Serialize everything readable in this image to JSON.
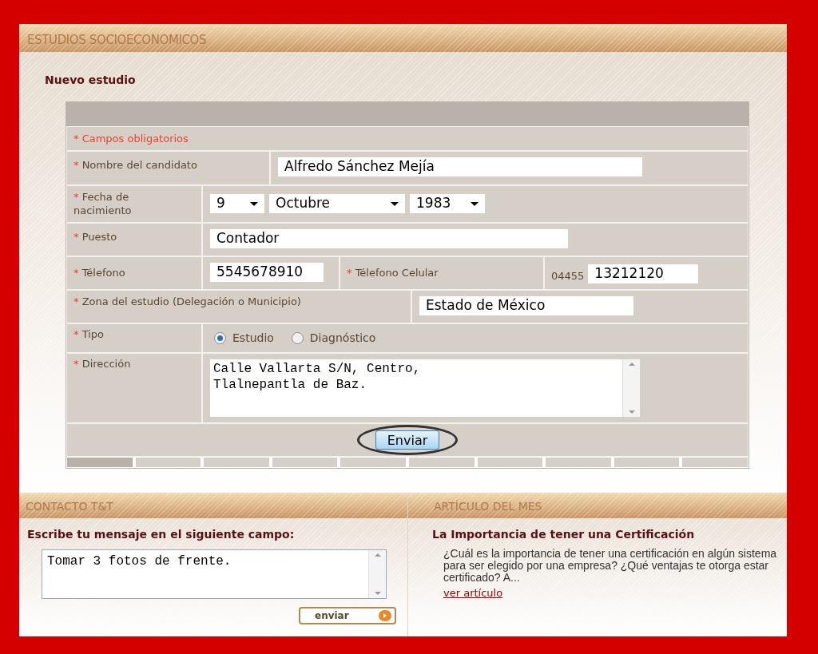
{
  "main": {
    "title": "ESTUDIOS SOCIOECONOMICOS",
    "subtitle": "Nuevo estudio",
    "required_note": "* Campos obligatorios",
    "name": {
      "label": "Nombre del candidato",
      "value": "Alfredo Sánchez Mejía"
    },
    "birth": {
      "label": "Fecha de nacimiento",
      "day": "9",
      "month": "Octubre",
      "year": "1983"
    },
    "position": {
      "label": "Puesto",
      "value": "Contador"
    },
    "phone": {
      "label": "Télefono",
      "value": "5545678910"
    },
    "mobile": {
      "label": "Télefono Celular",
      "prefix": "04455",
      "value": "13212120"
    },
    "zone": {
      "label": "Zona del estudio (Delegación o Municipio)",
      "value": "Estado de México"
    },
    "type": {
      "label": "Tipo",
      "options": [
        {
          "label": "Estudio",
          "selected": true
        },
        {
          "label": "Diagnóstico",
          "selected": false
        }
      ]
    },
    "address": {
      "label": "Dirección",
      "value": "Calle Vallarta S/N, Centro,\nTlalnepantla de Baz."
    },
    "submit": "Enviar",
    "required_mark": "*"
  },
  "contact": {
    "title": "CONTACTO T&T",
    "prompt": "Escribe tu mensaje en el siguiente campo:",
    "message": "Tomar 3 fotos de frente.",
    "send": "enviar"
  },
  "article": {
    "title": "ARTÍCULO DEL MES",
    "heading": "La Importancia de tener una Certificación",
    "text": "¿Cuál es la importancia de tener una certificación en algún sistema para ser elegido por una empresa? ¿Qué ventajas te otorga estar certificado? A...",
    "link": "ver artículo"
  }
}
